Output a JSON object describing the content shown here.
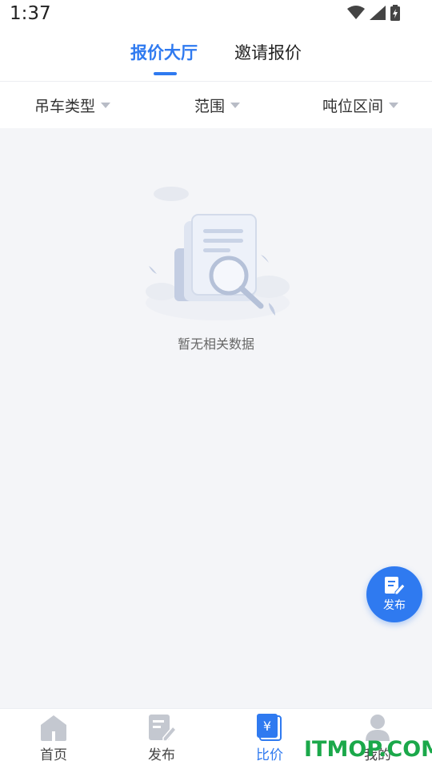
{
  "status_bar": {
    "time": "1:37"
  },
  "tabs": [
    {
      "label": "报价大厅",
      "active": true
    },
    {
      "label": "邀请报价",
      "active": false
    }
  ],
  "filters": [
    {
      "label": "吊车类型"
    },
    {
      "label": "范围"
    },
    {
      "label": "吨位区间"
    }
  ],
  "empty_state": {
    "text": "暂无相关数据"
  },
  "fab": {
    "label": "发布",
    "icon": "edit-doc-icon"
  },
  "bottom_nav": [
    {
      "label": "首页",
      "icon": "home-icon",
      "active": false
    },
    {
      "label": "发布",
      "icon": "edit-doc-icon",
      "active": false
    },
    {
      "label": "比价",
      "icon": "yen-doc-icon",
      "active": true
    },
    {
      "label": "我的",
      "icon": "user-icon",
      "active": false
    }
  ],
  "watermark": {
    "text": "ITMOP.COM"
  },
  "colors": {
    "accent": "#2f7af0",
    "background": "#f4f5f8",
    "watermark": "#1ba84a"
  }
}
